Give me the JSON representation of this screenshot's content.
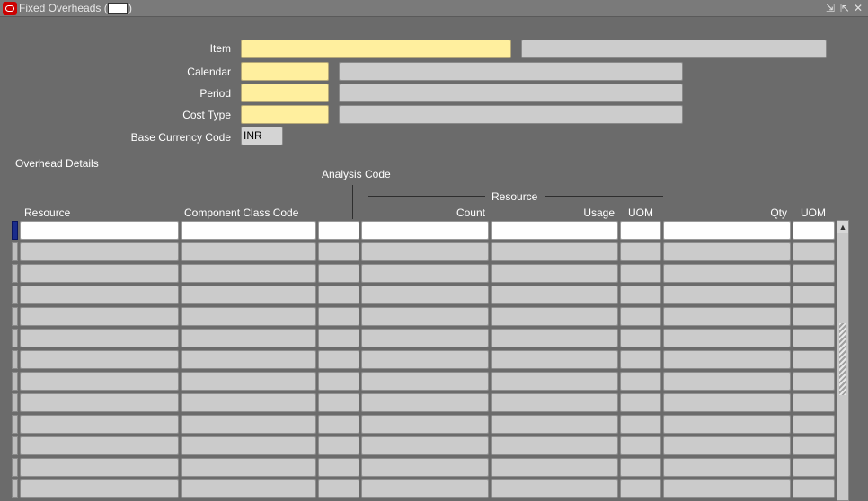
{
  "window": {
    "title": "Fixed Overheads (",
    "title_suffix": ")",
    "icons": [
      "minimize-icon",
      "maximize-icon",
      "close-icon"
    ],
    "buttons": {
      "minimize": "⇲",
      "maximize": "⇱",
      "close": "✕"
    }
  },
  "form": {
    "item_label": "Item",
    "calendar_label": "Calendar",
    "period_label": "Period",
    "cost_type_label": "Cost Type",
    "base_currency_label": "Base Currency Code",
    "base_currency_value": "INR"
  },
  "section": {
    "title": "Overhead Details"
  },
  "table": {
    "analysis_code_header": "Analysis Code",
    "resource_group_header": "Resource",
    "columns": {
      "resource": "Resource",
      "component_class_code": "Component Class Code",
      "count": "Count",
      "usage": "Usage",
      "usage_uom": "UOM",
      "qty": "Qty",
      "qty_uom": "UOM"
    },
    "row_count": 13
  },
  "colors": {
    "background": "#6b6b6b",
    "required_field": "#ffef9e",
    "current_record": "#1a2c8c"
  }
}
